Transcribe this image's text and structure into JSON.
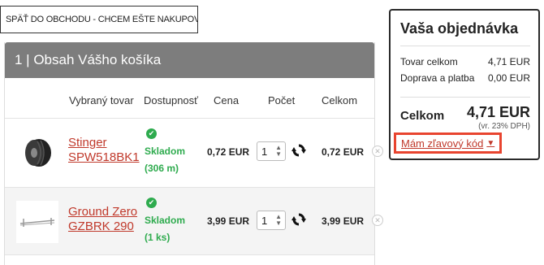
{
  "back_button": {
    "label": "SPÄŤ DO OBCHODU - CHCEM EŠTE NAKUPOVAŤ"
  },
  "cart": {
    "header": "1 | Obsah Vášho košíka",
    "columns": {
      "product": "Vybraný tovar",
      "availability": "Dostupnosť",
      "price": "Cena",
      "quantity": "Počet",
      "total": "Celkom"
    },
    "items": [
      {
        "name_line1": "Stinger",
        "name_line2": "SPW518BK1",
        "thumb_icon": "speaker-wire-spool-icon",
        "availability": "Skladom",
        "stock": "(306 m)",
        "price": "0,72 EUR",
        "quantity": "1",
        "total": "0,72 EUR"
      },
      {
        "name_line1": "Ground Zero",
        "name_line2": "GZBRK 290",
        "thumb_icon": "mounting-bracket-icon",
        "availability": "Skladom",
        "stock": "(1 ks)",
        "price": "3,99 EUR",
        "quantity": "1",
        "total": "3,99 EUR"
      }
    ]
  },
  "summary": {
    "title": "Vaša objednávka",
    "goods_label": "Tovar celkom",
    "goods_value": "4,71 EUR",
    "shipping_label": "Doprava a platba",
    "shipping_value": "0,00 EUR",
    "total_label": "Celkom",
    "total_value": "4,71 EUR",
    "vat_note": "(vr. 23% DPH)",
    "discount_link": "Mám zľavový kód"
  },
  "colors": {
    "accent_red": "#c0392b",
    "highlight_red": "#e8442f",
    "stock_green": "#2eab4e",
    "header_gray": "#7d7d7d"
  }
}
